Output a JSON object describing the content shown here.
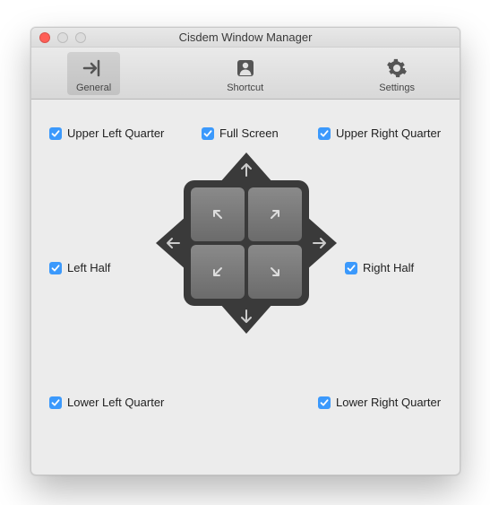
{
  "window": {
    "title": "Cisdem Window Manager"
  },
  "toolbar": {
    "items": [
      {
        "label": "General",
        "selected": true
      },
      {
        "label": "Shortcut",
        "selected": false
      },
      {
        "label": "Settings",
        "selected": false
      }
    ]
  },
  "options": {
    "upper_left": {
      "label": "Upper Left Quarter",
      "checked": true
    },
    "full_screen": {
      "label": "Full Screen",
      "checked": true
    },
    "upper_right": {
      "label": "Upper Right Quarter",
      "checked": true
    },
    "left_half": {
      "label": "Left Half",
      "checked": true
    },
    "right_half": {
      "label": "Right Half",
      "checked": true
    },
    "lower_left": {
      "label": "Lower Left Quarter",
      "checked": true
    },
    "lower_right": {
      "label": "Lower Right Quarter",
      "checked": true
    }
  },
  "colors": {
    "accent": "#3B99FC"
  }
}
